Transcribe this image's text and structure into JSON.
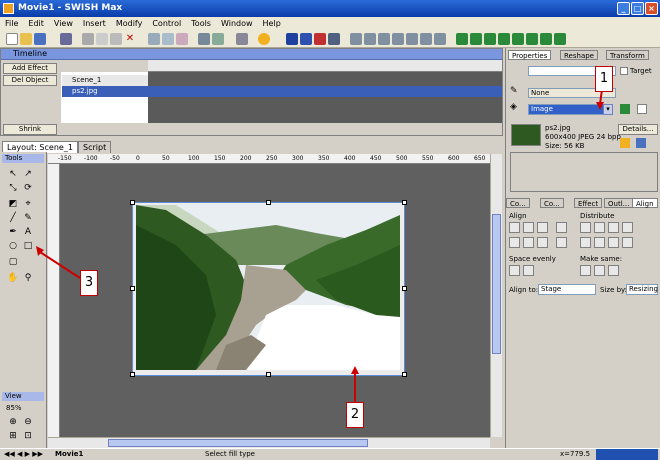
{
  "window": {
    "title": "Movie1 - SWISH Max"
  },
  "menu": [
    "File",
    "Edit",
    "View",
    "Insert",
    "Modify",
    "Control",
    "Tools",
    "Window",
    "Help"
  ],
  "timeline": {
    "title": "Timeline",
    "add_effect": "Add Effect",
    "del_object": "Del Object",
    "layers": [
      "Scene_1",
      "ps2.jpg"
    ],
    "shrink": "Shrink"
  },
  "doc_tabs": [
    "Layout: Scene_1",
    "Script"
  ],
  "tools": {
    "title": "Tools",
    "view_title": "View",
    "zoom": "85%"
  },
  "ruler": {
    "h_ticks": [
      "-150",
      "-100",
      "-50",
      "0",
      "50",
      "100",
      "150",
      "200",
      "250",
      "300",
      "350",
      "400",
      "450",
      "500",
      "550",
      "600",
      "650"
    ]
  },
  "right_panel": {
    "tabs": [
      "Properties",
      "Reshape",
      "Transform"
    ],
    "target_label": "Target",
    "line_value": "None",
    "fill_value": "Image",
    "image_name": "ps2.jpg",
    "image_info": "600x400 JPEG 24 bpp",
    "image_size": "Size: 56 KB",
    "details": "Details...",
    "tabs2": [
      "Co...",
      "Co...",
      "Effect",
      "Outl...",
      "Align"
    ],
    "align_label": "Align",
    "distribute_label": "Distribute",
    "space_evenly_label": "Space evenly",
    "make_same_label": "Make same:",
    "align_to_label": "Align to:",
    "align_to_value": "Stage",
    "size_by_label": "Size by:",
    "size_by_value": "Resizing"
  },
  "annotations": {
    "c1": "1",
    "c2": "2",
    "c3": "3"
  },
  "status": {
    "movie_tab": "Movie1",
    "hint": "Select fill type",
    "coords": "x=779.5"
  },
  "colors": {
    "accent": "#0a3ca8",
    "arrow": "#cc0000"
  }
}
